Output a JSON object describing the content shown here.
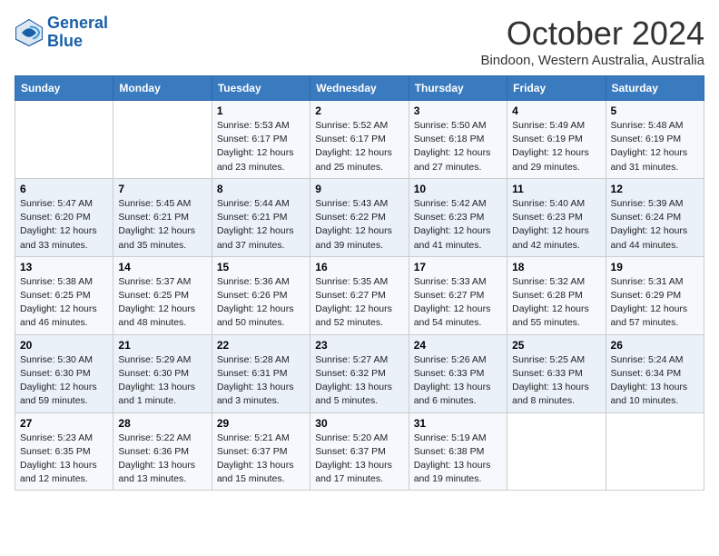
{
  "header": {
    "logo_line1": "General",
    "logo_line2": "Blue",
    "title": "October 2024",
    "subtitle": "Bindoon, Western Australia, Australia"
  },
  "days_of_week": [
    "Sunday",
    "Monday",
    "Tuesday",
    "Wednesday",
    "Thursday",
    "Friday",
    "Saturday"
  ],
  "weeks": [
    [
      {
        "day": "",
        "info": ""
      },
      {
        "day": "",
        "info": ""
      },
      {
        "day": "1",
        "info": "Sunrise: 5:53 AM\nSunset: 6:17 PM\nDaylight: 12 hours and 23 minutes."
      },
      {
        "day": "2",
        "info": "Sunrise: 5:52 AM\nSunset: 6:17 PM\nDaylight: 12 hours and 25 minutes."
      },
      {
        "day": "3",
        "info": "Sunrise: 5:50 AM\nSunset: 6:18 PM\nDaylight: 12 hours and 27 minutes."
      },
      {
        "day": "4",
        "info": "Sunrise: 5:49 AM\nSunset: 6:19 PM\nDaylight: 12 hours and 29 minutes."
      },
      {
        "day": "5",
        "info": "Sunrise: 5:48 AM\nSunset: 6:19 PM\nDaylight: 12 hours and 31 minutes."
      }
    ],
    [
      {
        "day": "6",
        "info": "Sunrise: 5:47 AM\nSunset: 6:20 PM\nDaylight: 12 hours and 33 minutes."
      },
      {
        "day": "7",
        "info": "Sunrise: 5:45 AM\nSunset: 6:21 PM\nDaylight: 12 hours and 35 minutes."
      },
      {
        "day": "8",
        "info": "Sunrise: 5:44 AM\nSunset: 6:21 PM\nDaylight: 12 hours and 37 minutes."
      },
      {
        "day": "9",
        "info": "Sunrise: 5:43 AM\nSunset: 6:22 PM\nDaylight: 12 hours and 39 minutes."
      },
      {
        "day": "10",
        "info": "Sunrise: 5:42 AM\nSunset: 6:23 PM\nDaylight: 12 hours and 41 minutes."
      },
      {
        "day": "11",
        "info": "Sunrise: 5:40 AM\nSunset: 6:23 PM\nDaylight: 12 hours and 42 minutes."
      },
      {
        "day": "12",
        "info": "Sunrise: 5:39 AM\nSunset: 6:24 PM\nDaylight: 12 hours and 44 minutes."
      }
    ],
    [
      {
        "day": "13",
        "info": "Sunrise: 5:38 AM\nSunset: 6:25 PM\nDaylight: 12 hours and 46 minutes."
      },
      {
        "day": "14",
        "info": "Sunrise: 5:37 AM\nSunset: 6:25 PM\nDaylight: 12 hours and 48 minutes."
      },
      {
        "day": "15",
        "info": "Sunrise: 5:36 AM\nSunset: 6:26 PM\nDaylight: 12 hours and 50 minutes."
      },
      {
        "day": "16",
        "info": "Sunrise: 5:35 AM\nSunset: 6:27 PM\nDaylight: 12 hours and 52 minutes."
      },
      {
        "day": "17",
        "info": "Sunrise: 5:33 AM\nSunset: 6:27 PM\nDaylight: 12 hours and 54 minutes."
      },
      {
        "day": "18",
        "info": "Sunrise: 5:32 AM\nSunset: 6:28 PM\nDaylight: 12 hours and 55 minutes."
      },
      {
        "day": "19",
        "info": "Sunrise: 5:31 AM\nSunset: 6:29 PM\nDaylight: 12 hours and 57 minutes."
      }
    ],
    [
      {
        "day": "20",
        "info": "Sunrise: 5:30 AM\nSunset: 6:30 PM\nDaylight: 12 hours and 59 minutes."
      },
      {
        "day": "21",
        "info": "Sunrise: 5:29 AM\nSunset: 6:30 PM\nDaylight: 13 hours and 1 minute."
      },
      {
        "day": "22",
        "info": "Sunrise: 5:28 AM\nSunset: 6:31 PM\nDaylight: 13 hours and 3 minutes."
      },
      {
        "day": "23",
        "info": "Sunrise: 5:27 AM\nSunset: 6:32 PM\nDaylight: 13 hours and 5 minutes."
      },
      {
        "day": "24",
        "info": "Sunrise: 5:26 AM\nSunset: 6:33 PM\nDaylight: 13 hours and 6 minutes."
      },
      {
        "day": "25",
        "info": "Sunrise: 5:25 AM\nSunset: 6:33 PM\nDaylight: 13 hours and 8 minutes."
      },
      {
        "day": "26",
        "info": "Sunrise: 5:24 AM\nSunset: 6:34 PM\nDaylight: 13 hours and 10 minutes."
      }
    ],
    [
      {
        "day": "27",
        "info": "Sunrise: 5:23 AM\nSunset: 6:35 PM\nDaylight: 13 hours and 12 minutes."
      },
      {
        "day": "28",
        "info": "Sunrise: 5:22 AM\nSunset: 6:36 PM\nDaylight: 13 hours and 13 minutes."
      },
      {
        "day": "29",
        "info": "Sunrise: 5:21 AM\nSunset: 6:37 PM\nDaylight: 13 hours and 15 minutes."
      },
      {
        "day": "30",
        "info": "Sunrise: 5:20 AM\nSunset: 6:37 PM\nDaylight: 13 hours and 17 minutes."
      },
      {
        "day": "31",
        "info": "Sunrise: 5:19 AM\nSunset: 6:38 PM\nDaylight: 13 hours and 19 minutes."
      },
      {
        "day": "",
        "info": ""
      },
      {
        "day": "",
        "info": ""
      }
    ]
  ]
}
